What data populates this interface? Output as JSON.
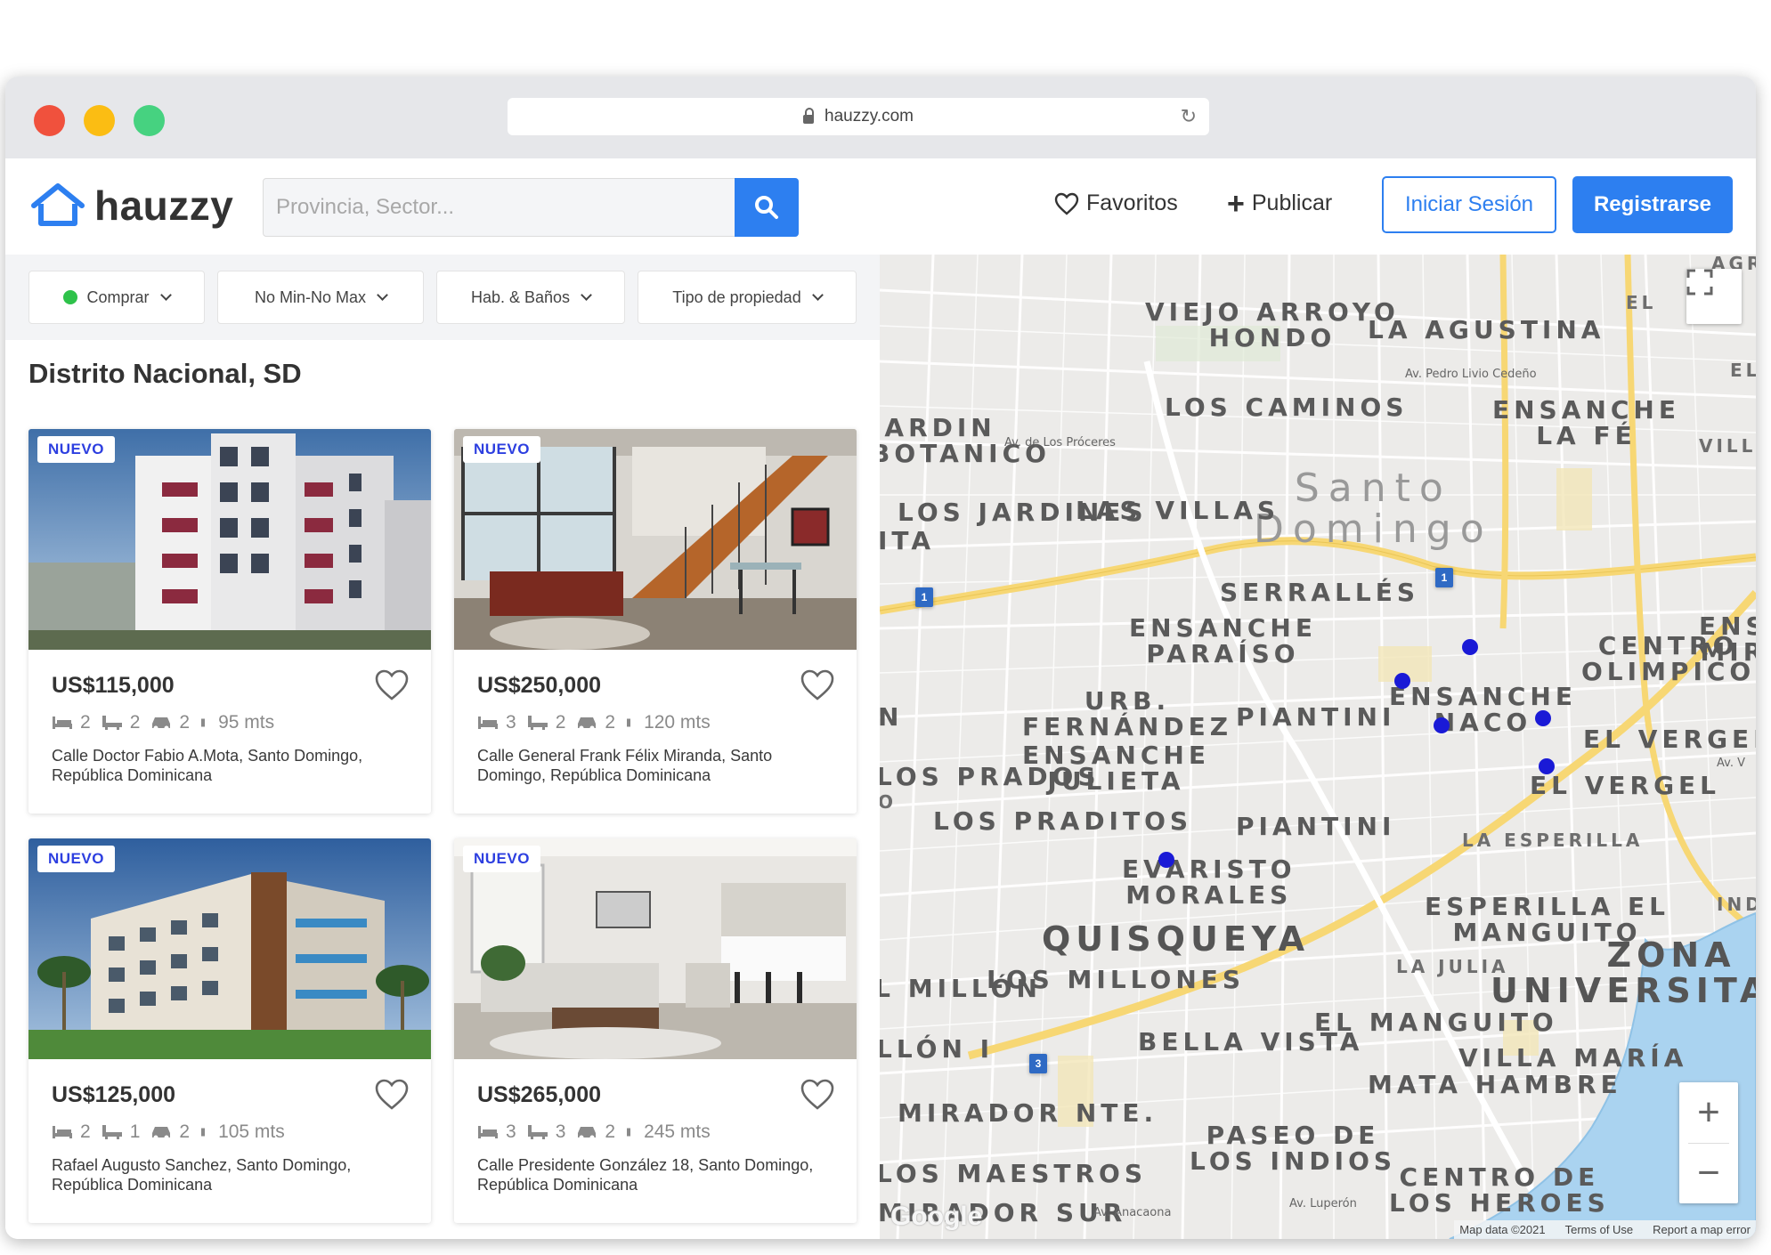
{
  "browser": {
    "url": "hauzzy.com"
  },
  "header": {
    "logo_text": "hauzzy",
    "search_placeholder": "Provincia, Sector...",
    "favorites_label": "Favoritos",
    "publish_label": "Publicar",
    "login_label": "Iniciar Sesión",
    "register_label": "Registrarse"
  },
  "filters": {
    "operation": "Comprar",
    "price": "No Min-No Max",
    "rooms": "Hab. & Baños",
    "type": "Tipo de propiedad"
  },
  "region_title": "Distrito Nacional, SD",
  "listings": [
    {
      "badge": "NUEVO",
      "price": "US$115,000",
      "beds": "2",
      "baths": "2",
      "parking": "2",
      "area": "95 mts",
      "address": "Calle Doctor Fabio A.Mota, Santo Domingo, República Dominicana",
      "photo": "apartment-tower-exterior"
    },
    {
      "badge": "NUEVO",
      "price": "US$250,000",
      "beds": "3",
      "baths": "2",
      "parking": "2",
      "area": "120 mts",
      "address": "Calle General Frank Félix Miranda, Santo Domingo, República Dominicana",
      "photo": "loft-living-room"
    },
    {
      "badge": "NUEVO",
      "price": "US$125,000",
      "beds": "2",
      "baths": "1",
      "parking": "2",
      "area": "105 mts",
      "address": "Rafael Augusto Sanchez, Santo Domingo, República Dominicana",
      "photo": "apartment-building-palms"
    },
    {
      "badge": "NUEVO",
      "price": "US$265,000",
      "beds": "3",
      "baths": "3",
      "parking": "2",
      "area": "245 mts",
      "address": "Calle Presidente González 18, Santo Domingo, República Dominicana",
      "photo": "modern-living-kitchen"
    }
  ],
  "map": {
    "labels": {
      "city": "Santo\nDomingo",
      "viejo_arroyo": "VIEJO ARROYO\nHONDO",
      "la_agustina": "LA AGUSTINA",
      "los_caminos": "LOS CAMINOS",
      "ensanche_la_fe": "ENSANCHE\nLA FÉ",
      "jardin_botanico": "JARDIN\nBOTANICO",
      "los_jardines": "LOS JARDINES",
      "las_villas": "LAS VILLAS",
      "serralles": "SERRALLÉS",
      "ensanche_paraiso": "ENSANCHE\nPARAÍSO",
      "urb_fernandez": "URB.\nFERNÁNDEZ",
      "piantini_1": "PIANTINI",
      "ensanche_naco": "ENSANCHE\nNACO",
      "centro_olimpico": "CENTRO\nOLIMPICO",
      "ensanche_mirador": "ENSA\nMIRA",
      "el_vergel_1": "EL VERGEL",
      "el_vergel_2": "EL VERGEL",
      "ensanche_julieta": "ENSANCHE\nJULIETA",
      "los_prados": "LOS PRADOS",
      "los_praditos": "LOS PRADITOS",
      "piantini_2": "PIANTINI",
      "la_esperilla": "LA ESPERILLA",
      "evaristo_morales": "EVARISTO\nMORALES",
      "esperilla_manguito": "ESPERILLA EL\nMANGUITO",
      "quisqueya": "QUISQUEYA",
      "la_julia": "LA JULIA",
      "zona_universitaria": "ZONA\nUNIVERSITARIA",
      "los_millones": "LOS MILLONES",
      "el_millon": "EL MILLÓN",
      "el_manguito": "EL MANGUITO",
      "bella_vista": "BELLA VISTA",
      "villa_maria": "VILLA MARÍA",
      "mata_hambre": "MATA HAMBRE",
      "mirador_norte": "MIRADOR NTE.",
      "paseo_indios": "PASEO DE\nLOS INDIOS",
      "los_maestros": "LOS MAESTROS",
      "centro_heroes": "CENTRO DE\nLOS HEROES",
      "mirador_sur": "MIRADOR SUR",
      "agr": "AGR",
      "villa": "VILLA",
      "ind": "IND",
      "av_proceres": "Av. de Los Próceres",
      "av_pedro": "Av. Pedro Livio Cedeño",
      "route_1": "1",
      "route_2": "1",
      "route_3": "3",
      "el_top": "EL",
      "el_mid": "EL",
      "ita": "ITA",
      "n_left": "N",
      "o_left": "O",
      "llon": "LLÓN I",
      "av_short": "Av. V",
      "bottom_road": "Av. Anacaona",
      "bottom_road2": "Av. Luperón"
    },
    "google_text": "Google",
    "attribution": [
      "Map data ©2021",
      "Terms of Use",
      "Report a map error"
    ],
    "zoom_in": "+",
    "zoom_out": "−"
  },
  "colors": {
    "brand_blue": "#2d7ff0",
    "badge_text": "#2d3fe0",
    "pin": "#1a1ad6"
  }
}
